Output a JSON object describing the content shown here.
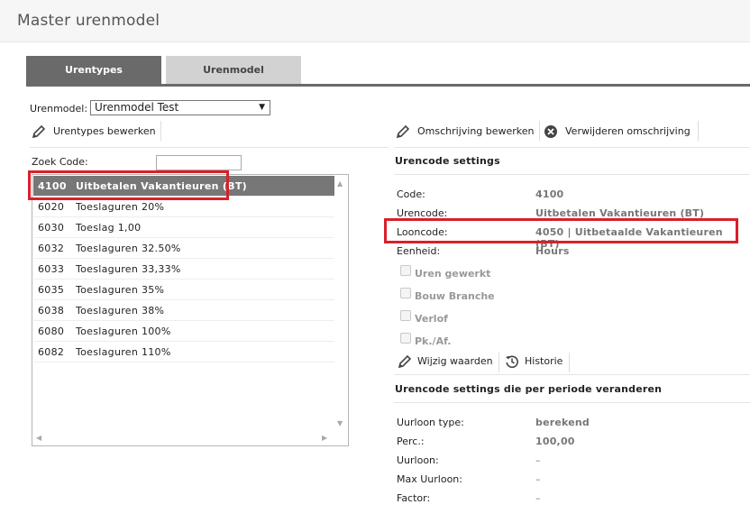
{
  "page": {
    "title": "Master urenmodel"
  },
  "tabs": [
    {
      "label": "Urentypes"
    },
    {
      "label": "Urenmodel"
    }
  ],
  "urenmodel": {
    "label": "Urenmodel:",
    "selected": "Urenmodel Test"
  },
  "left_toolbar": {
    "edit_label": "Urentypes bewerken"
  },
  "right_toolbar": {
    "edit_label": "Omschrijving bewerken",
    "delete_label": "Verwijderen omschrijving"
  },
  "search": {
    "label": "Zoek Code:",
    "value": ""
  },
  "list": {
    "rows": [
      {
        "code": "4100",
        "desc": "Uitbetalen Vakantieuren (BT)"
      },
      {
        "code": "6020",
        "desc": "Toeslaguren 20%"
      },
      {
        "code": "6030",
        "desc": "Toeslag 1,00"
      },
      {
        "code": "6032",
        "desc": "Toeslaguren 32.50%"
      },
      {
        "code": "6033",
        "desc": "Toeslaguren 33,33%"
      },
      {
        "code": "6035",
        "desc": "Toeslaguren 35%"
      },
      {
        "code": "6038",
        "desc": "Toeslaguren 38%"
      },
      {
        "code": "6080",
        "desc": "Toeslaguren 100%"
      },
      {
        "code": "6082",
        "desc": "Toeslaguren 110%"
      }
    ],
    "selected_index": 0
  },
  "settings": {
    "title": "Urencode settings",
    "fields": [
      {
        "label": "Code:",
        "value": "4100"
      },
      {
        "label": "Urencode:",
        "value": "Uitbetalen Vakantieuren (BT)"
      },
      {
        "label": "Looncode:",
        "value": "4050 | Uitbetaalde Vakantieuren (BT)"
      },
      {
        "label": "Eenheid:",
        "value": "Hours"
      }
    ],
    "checkboxes": [
      {
        "label": "Uren gewerkt",
        "checked": false
      },
      {
        "label": "Bouw Branche",
        "checked": false
      },
      {
        "label": "Verlof",
        "checked": false
      },
      {
        "label": "Pk./Af.",
        "checked": false
      }
    ],
    "edit_label": "Wijzig waarden",
    "history_label": "Historie"
  },
  "period_settings": {
    "title": "Urencode settings die per periode veranderen",
    "fields": [
      {
        "label": "Uurloon type:",
        "value": "berekend"
      },
      {
        "label": "Perc.:",
        "value": "100,00"
      },
      {
        "label": "Uurloon:",
        "value": "–"
      },
      {
        "label": "Max Uurloon:",
        "value": "–"
      },
      {
        "label": "Factor:",
        "value": "–"
      }
    ]
  },
  "colors": {
    "highlight": "#d9202a",
    "tab_active": "#6a6a6a",
    "tab_inactive": "#d2d2d2",
    "selected_row": "#777777"
  },
  "icons": {
    "edit": "pencil-icon",
    "delete": "close-circle-icon",
    "history": "history-icon"
  }
}
